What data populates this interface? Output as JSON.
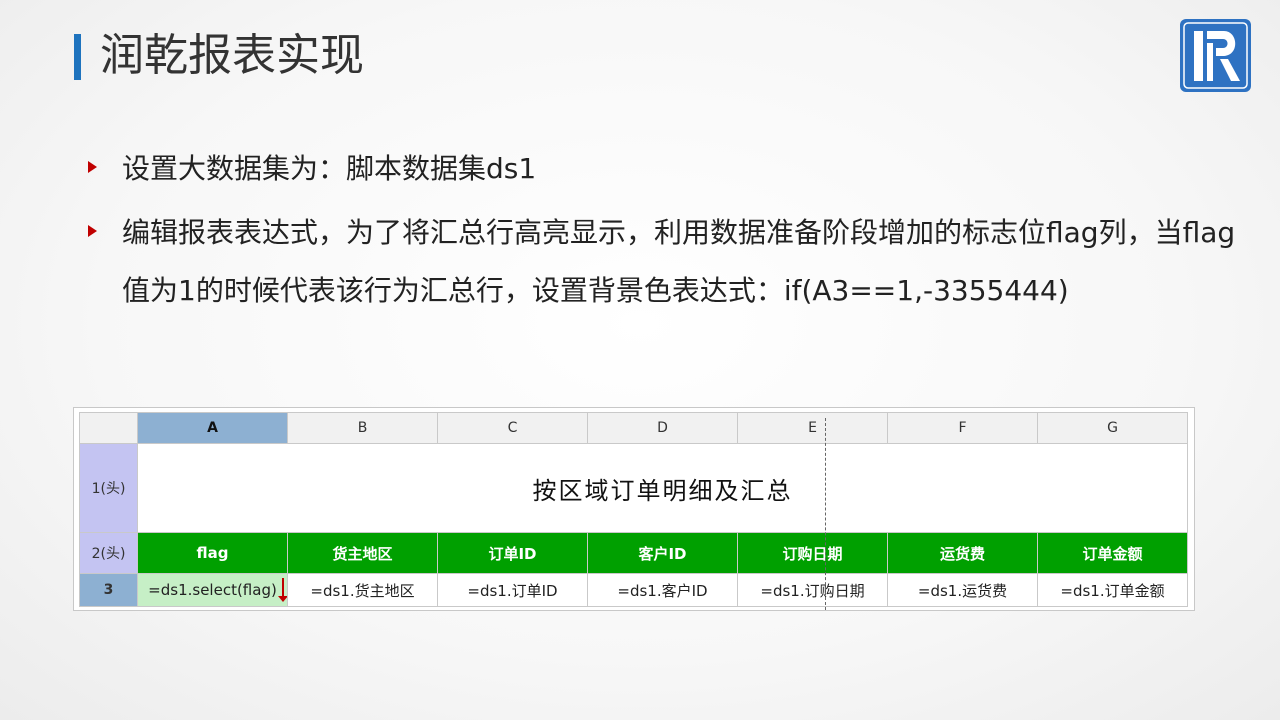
{
  "slide": {
    "title": "润乾报表实现",
    "accent_color": "#1e73be",
    "bullet_color": "#c00000",
    "bullets": [
      "设置大数据集为：脚本数据集ds1",
      "编辑报表表达式，为了将汇总行高亮显示，利用数据准备阶段增加的标志位flag列，当flag值为1的时候代表该行为汇总行，设置背景色表达式：if(A3==1,-3355444)"
    ]
  },
  "logo": {
    "icon": "runqian-r-logo-icon",
    "color": "#2e72c2"
  },
  "sheet": {
    "columns": [
      "A",
      "B",
      "C",
      "D",
      "E",
      "F",
      "G"
    ],
    "row_labels": [
      "1(头)",
      "2(头)",
      "3"
    ],
    "report_title": "按区域订单明细及汇总",
    "header_color": "#00a000",
    "headers": [
      "flag",
      "货主地区",
      "订单ID",
      "客户ID",
      "订购日期",
      "运货费",
      "订单金额"
    ],
    "cells": [
      "=ds1.select(flag)",
      "=ds1.货主地区",
      "=ds1.订单ID",
      "=ds1.客户ID",
      "=ds1.订购日期",
      "=ds1.运货费",
      "=ds1.订单金额"
    ]
  }
}
